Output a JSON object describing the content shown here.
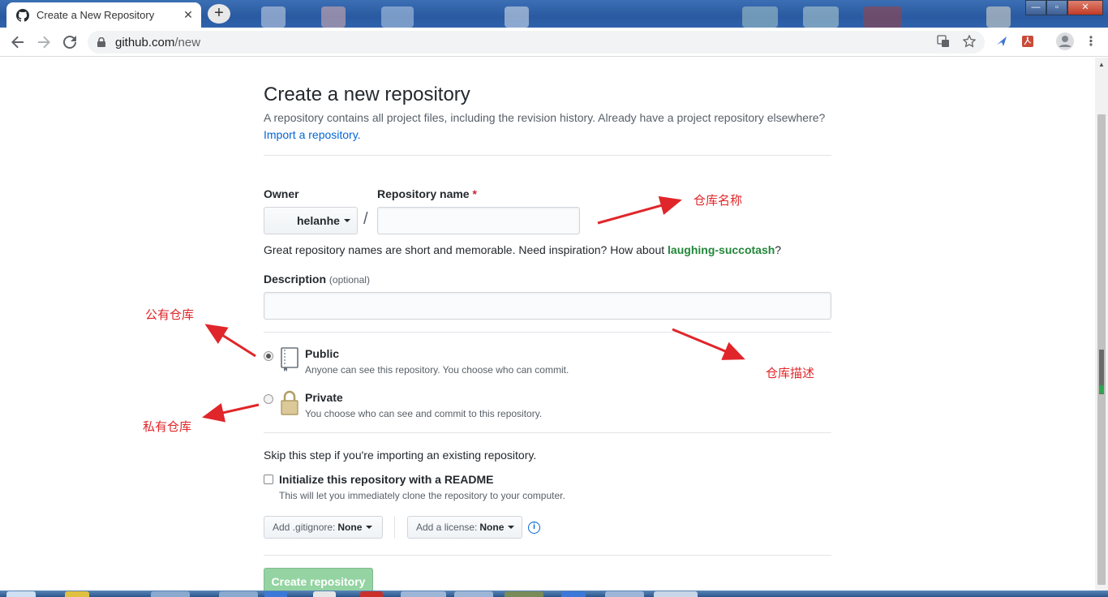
{
  "browser": {
    "tab_title": "Create a New Repository",
    "tab_close": "✕",
    "new_tab": "+",
    "url_host": "github.com",
    "url_path": "/new",
    "win_min": "—",
    "win_max": "▫",
    "win_close": "✕"
  },
  "page": {
    "title": "Create a new repository",
    "subtitle": "A repository contains all project files, including the revision history. Already have a project repository elsewhere?",
    "import_link": "Import a repository.",
    "owner_label": "Owner",
    "owner_value": "helanhe",
    "slash": "/",
    "repo_name_label": "Repository name",
    "required_mark": "*",
    "repo_name_value": "",
    "hint_prefix": "Great repository names are short and memorable. Need inspiration? How about",
    "hint_suggestion": "laughing-succotash",
    "hint_suffix": "?",
    "description_label": "Description",
    "description_optional": "(optional)",
    "description_value": "",
    "public_title": "Public",
    "public_desc": "Anyone can see this repository. You choose who can commit.",
    "private_title": "Private",
    "private_desc": "You choose who can see and commit to this repository.",
    "skip_text": "Skip this step if you're importing an existing repository.",
    "readme_title": "Initialize this repository with a README",
    "readme_desc": "This will let you immediately clone the repository to your computer.",
    "gitignore_label": "Add .gitignore:",
    "gitignore_value": "None",
    "license_label": "Add a license:",
    "license_value": "None",
    "info_glyph": "i",
    "create_button": "Create repository"
  },
  "annotations": {
    "repo_name": "仓库名称",
    "public": "公有仓库",
    "description": "仓库描述",
    "private": "私有仓库"
  },
  "state": {
    "visibility_selected": "public",
    "readme_checked": false
  },
  "colors": {
    "annotation": "#e0262a",
    "link": "#0366d6",
    "create_button_disabled": "#94d3a2"
  }
}
